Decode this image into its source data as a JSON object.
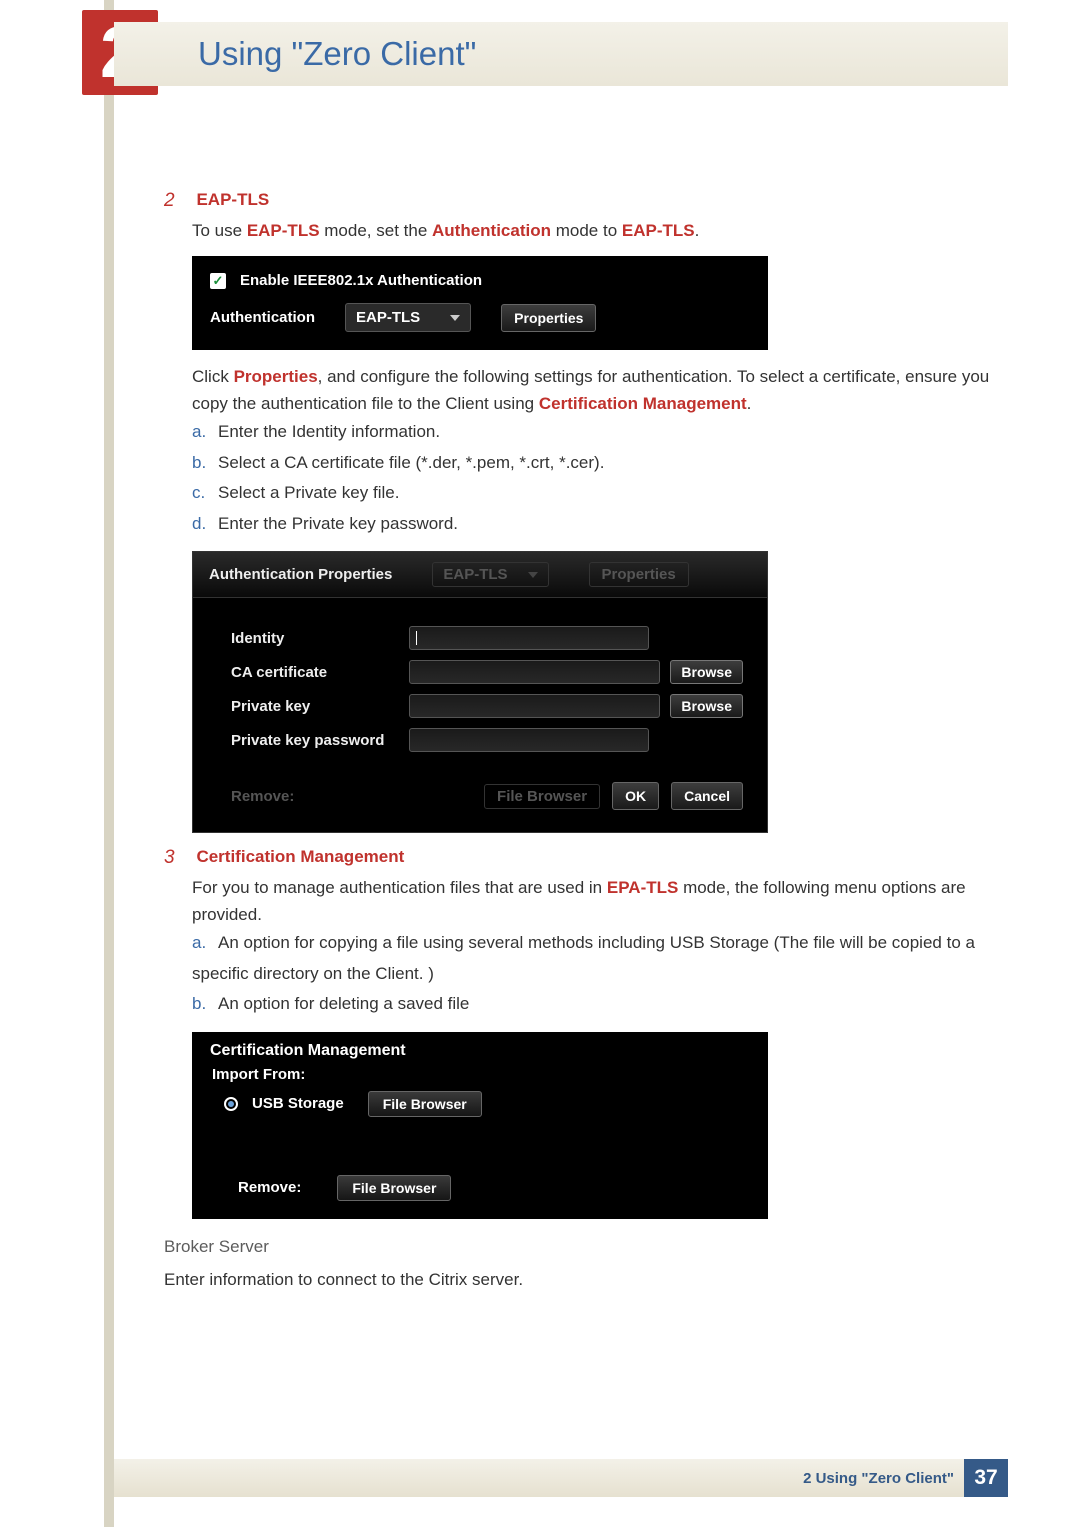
{
  "chapter": {
    "number": "2",
    "title": "Using \"Zero Client\""
  },
  "step2": {
    "num": "2",
    "title": "EAP-TLS",
    "intro_pre": "To use ",
    "intro_b1": "EAP-TLS",
    "intro_mid1": " mode, set the ",
    "intro_b2": "Authentication",
    "intro_mid2": " mode to ",
    "intro_b3": "EAP-TLS",
    "intro_end": ".",
    "ss1": {
      "enable_label": "Enable IEEE802.1x Authentication",
      "auth_label": "Authentication",
      "combo_value": "EAP-TLS",
      "properties_btn": "Properties"
    },
    "para2_pre": "Click ",
    "para2_b1": "Properties",
    "para2_mid": ", and configure the following settings for authentication. To select a certificate, ensure you copy the authentication file to the Client using ",
    "para2_b2": "Certification Management",
    "para2_end": ".",
    "steps": {
      "a_m": "a.",
      "a_pre": "Enter the ",
      "a_b": "Identity",
      "a_post": " information.",
      "b_m": "b.",
      "b_pre": "Select a ",
      "b_b": "CA certificate",
      "b_post": " file (*.der, *.pem, *.crt, *.cer).",
      "c_m": "c.",
      "c_pre": "Select a ",
      "c_b": "Private key",
      "c_post": " file.",
      "d_m": "d.",
      "d_pre": "Enter the ",
      "d_b": "Private key password",
      "d_post": "."
    },
    "ss2": {
      "header_title": "Authentication Properties",
      "header_ghost_combo": "EAP-TLS",
      "header_ghost_btn": "Properties",
      "identity": "Identity",
      "ca": "CA certificate",
      "pk": "Private key",
      "pkpw": "Private key password",
      "browse": "Browse",
      "remove_ghost": "Remove:",
      "filebrowser_ghost": "File Browser",
      "ok": "OK",
      "cancel": "Cancel"
    }
  },
  "step3": {
    "num": "3",
    "title": "Certification Management",
    "intro_pre": "For you to manage authentication files that are used in ",
    "intro_b1": "EPA-TLS",
    "intro_post": " mode, the following menu options are provided.",
    "steps": {
      "a_m": "a.",
      "a_pre": "An option for copying a file using several methods including ",
      "a_b": "USB Storage",
      "a_post": " (The file will be copied to a specific directory on the Client. )",
      "b_m": "b.",
      "b_text": "An option for deleting a saved file"
    },
    "ss3": {
      "title": "Certification Management",
      "import_from": "Import From:",
      "usb_storage": "USB Storage",
      "file_browser": "File Browser",
      "remove": "Remove:"
    }
  },
  "broker": {
    "heading": "Broker Server",
    "text": "Enter information to connect to the Citrix server."
  },
  "footer": {
    "section": "2 Using \"Zero Client\"",
    "page": "37"
  }
}
